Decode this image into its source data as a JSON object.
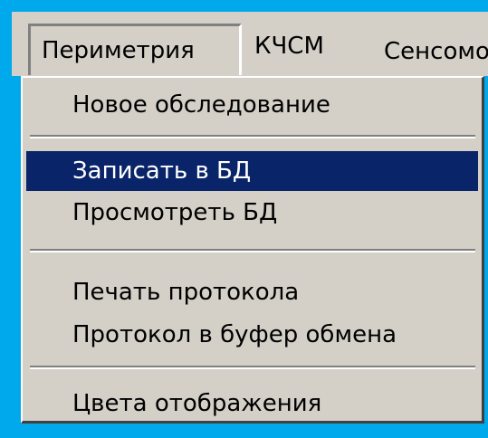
{
  "menubar": {
    "items": [
      {
        "label": "Периметрия"
      },
      {
        "label": "КЧСМ"
      },
      {
        "label": "Сенсомот"
      }
    ]
  },
  "menu": {
    "items": [
      {
        "label": "Новое обследование"
      },
      {
        "label": "Записать в БД",
        "highlighted": true
      },
      {
        "label": "Просмотреть БД"
      },
      {
        "label": "Печать протокола"
      },
      {
        "label": "Протокол в буфер обмена"
      },
      {
        "label": "Цвета отображения"
      }
    ]
  },
  "colors": {
    "background": "#00a8ec",
    "menu_face": "#d4d0c8",
    "highlight": "#0a246a",
    "highlight_text": "#ffffff"
  }
}
